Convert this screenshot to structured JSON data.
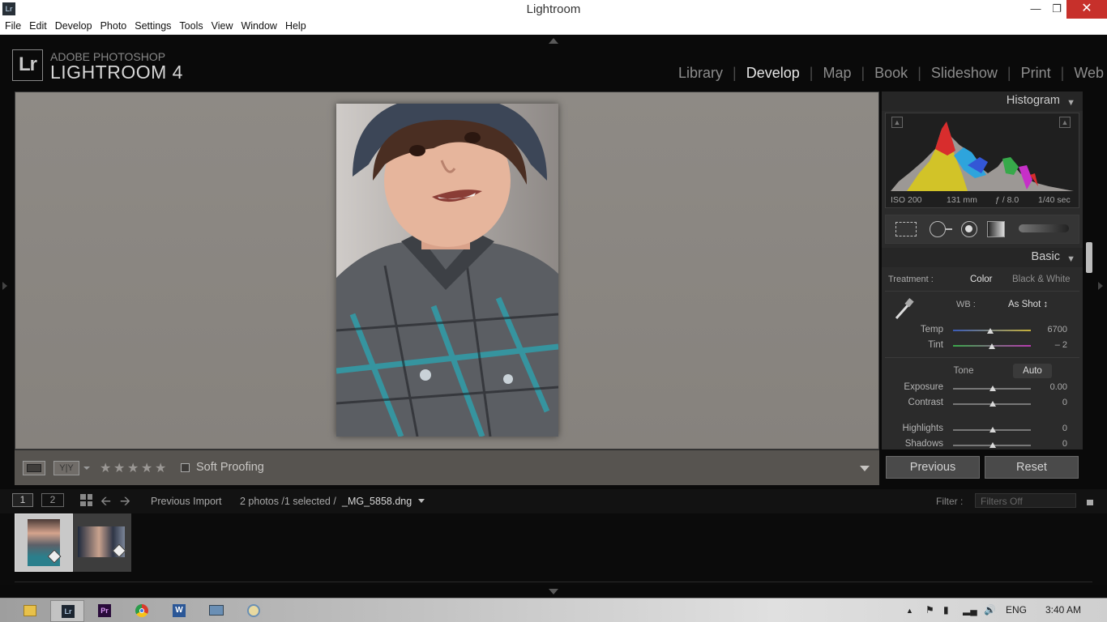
{
  "window": {
    "title": "Lightroom"
  },
  "menu": [
    "File",
    "Edit",
    "Develop",
    "Photo",
    "Settings",
    "Tools",
    "View",
    "Window",
    "Help"
  ],
  "brand": {
    "logo": "Lr",
    "line1": "ADOBE PHOTOSHOP",
    "line2": "LIGHTROOM 4"
  },
  "modules": [
    "Library",
    "Develop",
    "Map",
    "Book",
    "Slideshow",
    "Print",
    "Web"
  ],
  "active_module": "Develop",
  "toolbar": {
    "soft_proofing": "Soft Proofing",
    "view_compare": "Y|Y",
    "stars": 5
  },
  "histogram": {
    "title": "Histogram",
    "iso": "ISO 200",
    "focal": "131 mm",
    "aperture": "ƒ / 8.0",
    "shutter": "1/40 sec"
  },
  "basic": {
    "title": "Basic",
    "treatment_label": "Treatment :",
    "treatment_color": "Color",
    "treatment_bw": "Black & White",
    "wb_label": "WB :",
    "wb_value": "As Shot ↕",
    "temp_label": "Temp",
    "temp_value": "6700",
    "tint_label": "Tint",
    "tint_value": "– 2",
    "tone_label": "Tone",
    "auto_label": "Auto",
    "exposure_label": "Exposure",
    "exposure_value": "0.00",
    "contrast_label": "Contrast",
    "contrast_value": "0",
    "highlights_label": "Highlights",
    "highlights_value": "0",
    "shadows_label": "Shadows",
    "shadows_value": "0"
  },
  "buttons": {
    "previous": "Previous",
    "reset": "Reset"
  },
  "filmstrip": {
    "page1": "1",
    "page2": "2",
    "source": "Previous Import",
    "selection": "2 photos /1 selected /",
    "filename": "_MG_5858.dng",
    "filter_label": "Filter :",
    "filter_value": "Filters Off"
  },
  "taskbar": {
    "lang": "ENG",
    "time": "3:40 AM"
  }
}
